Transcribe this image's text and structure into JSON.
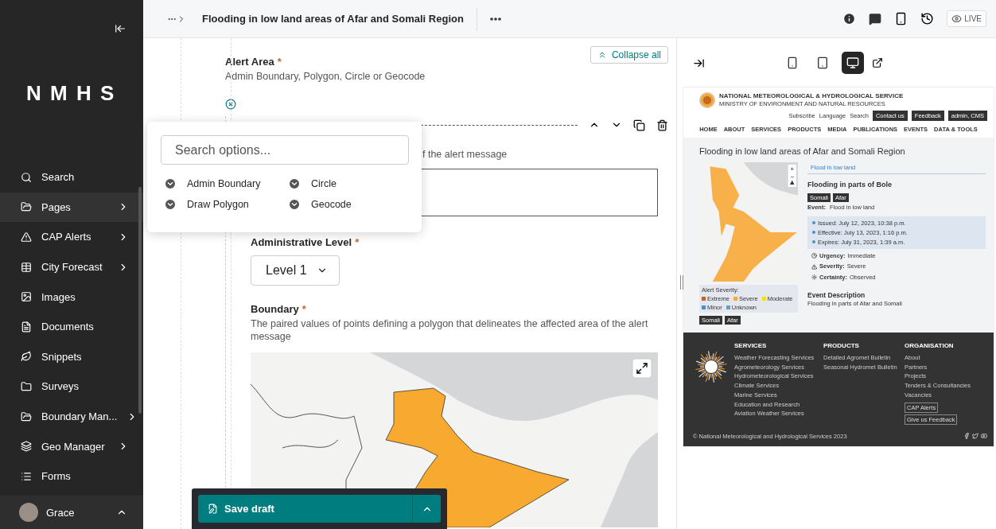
{
  "sidebar": {
    "logo": "N M H S",
    "items": [
      {
        "label": "Search",
        "expandable": false,
        "selected": false
      },
      {
        "label": "Pages",
        "expandable": true,
        "selected": true
      },
      {
        "label": "CAP Alerts",
        "expandable": true,
        "selected": false
      },
      {
        "label": "City Forecast",
        "expandable": true,
        "selected": false
      },
      {
        "label": "Images",
        "expandable": false,
        "selected": false
      },
      {
        "label": "Documents",
        "expandable": false,
        "selected": false
      },
      {
        "label": "Snippets",
        "expandable": false,
        "selected": false
      },
      {
        "label": "Surveys",
        "expandable": false,
        "selected": false
      },
      {
        "label": "Boundary Man...",
        "expandable": true,
        "selected": false
      },
      {
        "label": "Geo Manager",
        "expandable": true,
        "selected": false
      },
      {
        "label": "Forms",
        "expandable": false,
        "selected": false
      }
    ],
    "user": {
      "name": "Grace"
    }
  },
  "header": {
    "title": "Flooding in low land areas of Afar and Somali Region",
    "live_label": "LIVE"
  },
  "form": {
    "collapse_button": "Collapse all",
    "alert_area": {
      "label": "Alert Area",
      "mark": "*",
      "help": "Admin Boundary, Polygon, Circle or Geocode"
    },
    "popover": {
      "placeholder": "Search options...",
      "options": [
        "Admin Boundary",
        "Circle",
        "Draw Polygon",
        "Geocode"
      ]
    },
    "covered_help": "f the alert message",
    "admin_level": {
      "label": "Administrative Level",
      "mark": "*",
      "value": "Level 1"
    },
    "boundary": {
      "label": "Boundary",
      "mark": "*",
      "help": "The paired values of points defining a polygon that delineates the affected area of the alert message"
    },
    "save_button": "Save draft"
  },
  "preview": {
    "devices": [
      {
        "kind": "mobile",
        "selected": false
      },
      {
        "kind": "tablet",
        "selected": false
      },
      {
        "kind": "desktop",
        "selected": true
      }
    ],
    "site": {
      "org_name": "NATIONAL METEOROLOGICAL & HYDROLOGICAL SERVICE",
      "org_sub": "MINISTRY OF ENVIRONMENT AND NATURAL RESOURCES",
      "top_links": [
        "Subscribe",
        "Language",
        "Search"
      ],
      "top_buttons": [
        "Contact us",
        "Feedback",
        "admin, CMS"
      ],
      "nav": [
        "HOME",
        "ABOUT",
        "SERVICES",
        "PRODUCTS",
        "MEDIA",
        "PUBLICATIONS",
        "EVENTS",
        "DATA & TOOLS"
      ],
      "page_title": "Flooding in low land areas of Afar and Somali Region",
      "map_controls": [
        "+",
        "−"
      ],
      "legend_title": "Alert Severity:",
      "legend": [
        {
          "label": "Extreme",
          "color": "#c0652a"
        },
        {
          "label": "Severe",
          "color": "#f7a840"
        },
        {
          "label": "Moderate",
          "color": "#f5e10a"
        },
        {
          "label": "Minor",
          "color": "#4a90c8"
        },
        {
          "label": "Unknown",
          "color": "#5fa0d0"
        }
      ],
      "map_tags": [
        "Somali",
        "Afar"
      ],
      "tab": "Flood in low land",
      "alert_title": "Flooding in parts of Bole",
      "tags": [
        "Somali",
        "Afar"
      ],
      "event_label": "Event:",
      "event_value": "Flood in low land",
      "timeline": [
        "Issued: July 12, 2023, 10:38 p.m.",
        "Effective: July 13, 2023, 1:16 p.m.",
        "Expires: July 31, 2023, 1:39 a.m."
      ],
      "properties": [
        {
          "label": "Urgency:",
          "value": "Immediate"
        },
        {
          "label": "Severity:",
          "value": "Severe"
        },
        {
          "label": "Certainty:",
          "value": "Observed"
        }
      ],
      "description_title": "Event Description",
      "description": "Flooding in parts of Afar and Somali",
      "footer": {
        "columns": [
          {
            "title": "SERVICES",
            "links": [
              "Weather Forecasting Services",
              "Agrometeorology Services",
              "Hydrometeorological Services",
              "Climate Services",
              "Marine Services",
              "Education and Research",
              "Aviation Weather Services"
            ]
          },
          {
            "title": "PRODUCTS",
            "links": [
              "Detailed Agromet Bulletin",
              "Seasonal Hydromet Bulletin"
            ]
          },
          {
            "title": "ORGANISATION",
            "links": [
              "About",
              "Partners",
              "Projects",
              "Tenders & Consultancies",
              "Vacancies"
            ],
            "buttons": [
              "CAP Alerts",
              "Give us Feedback"
            ]
          }
        ],
        "copyright": "© National Meteorological and Hydrological Services 2023"
      }
    }
  }
}
